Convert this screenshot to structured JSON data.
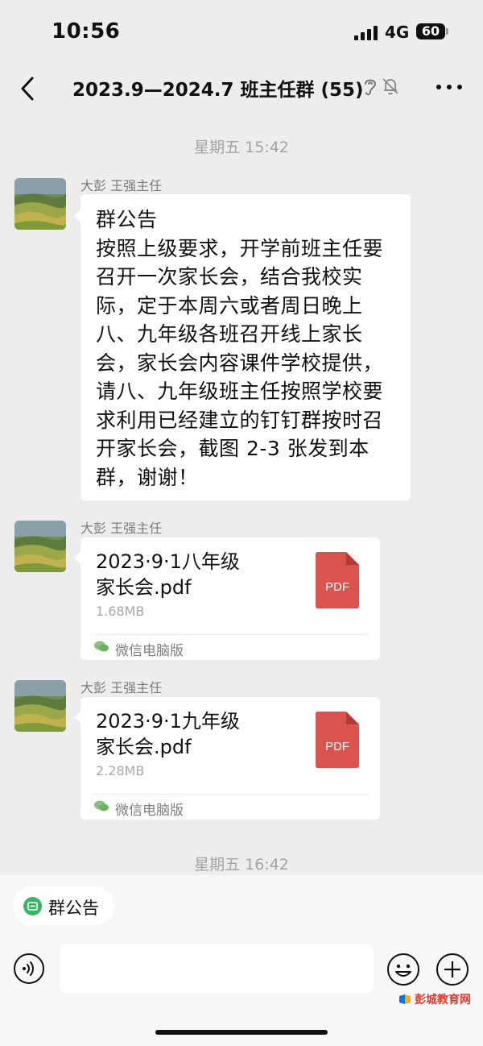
{
  "status_bar": {
    "time": "10:56",
    "network": "4G",
    "battery": "60"
  },
  "header": {
    "title": "2023.9—2024.7 班主任群 (55)"
  },
  "chat": {
    "timestamps": [
      "星期五 15:42",
      "星期五 16:42"
    ],
    "messages": [
      {
        "sender": "大彭 王强主任",
        "text": "群公告\n按照上级要求，开学前班主任要召开一次家长会，结合我校实际，定于本周六或者周日晚上八、九年级各班召开线上家长会，家长会内容课件学校提供，请八、九年级班主任按照学校要求利用已经建立的钉钉群按时召开家长会，截图 2-3 张发到本群，谢谢！"
      },
      {
        "sender": "大彭 王强主任",
        "file_name": "2023·9·1八年级\n家长会.pdf",
        "file_size": "1.68MB",
        "file_type": "PDF",
        "source": "微信电脑版"
      },
      {
        "sender": "大彭 王强主任",
        "file_name": "2023·9·1九年级\n家长会.pdf",
        "file_size": "2.28MB",
        "file_type": "PDF",
        "source": "微信电脑版"
      }
    ]
  },
  "bottom": {
    "notice_chip": "群公告",
    "input_placeholder": ""
  },
  "watermark": {
    "text": "彭城教育网"
  },
  "colors": {
    "background": "#ededed",
    "pdf_red": "#d9534f",
    "wechat_green": "#3ab465",
    "watermark_red": "#e03a2e"
  },
  "icons": [
    "back-icon",
    "ear-icon",
    "mute-icon",
    "more-icon",
    "pdf-icon",
    "wechat-icon",
    "notice-icon",
    "voice-icon",
    "emoji-icon",
    "add-icon"
  ]
}
